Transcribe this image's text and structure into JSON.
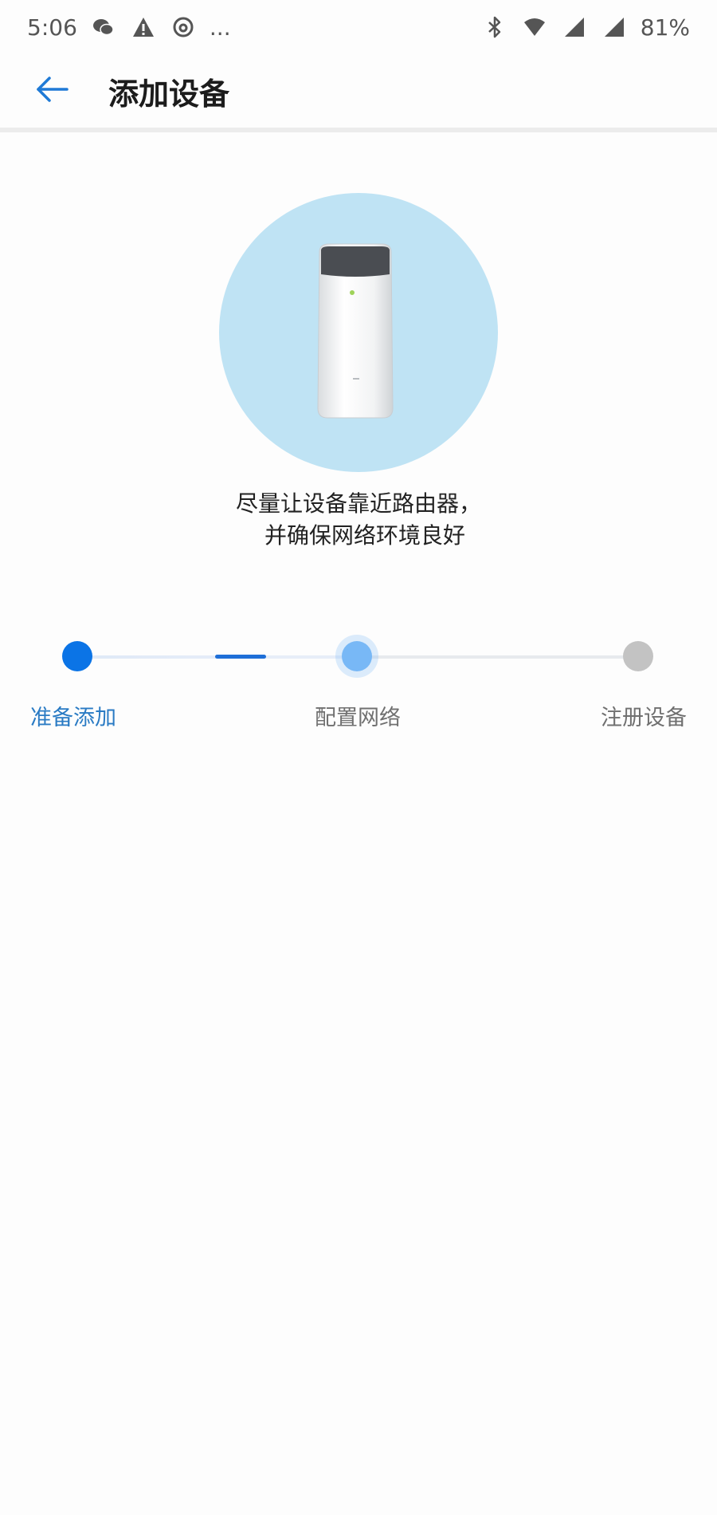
{
  "status_bar": {
    "time": "5:06",
    "more": "...",
    "battery": "81%",
    "icons_left": [
      "wechat-icon",
      "warning-icon",
      "netease-music-icon"
    ],
    "icons_right": [
      "bluetooth-icon",
      "wifi-icon",
      "signal-icon",
      "signal-icon"
    ]
  },
  "header": {
    "title": "添加设备",
    "back_icon": "arrow-left-icon"
  },
  "illustration": {
    "circle_color": "#bfe3f4",
    "device": "air-purifier-icon"
  },
  "hint": {
    "line1": "尽量让设备靠近路由器，",
    "line2": "并确保网络环境良好"
  },
  "stepper": {
    "current_step": 1,
    "steps": [
      {
        "label": "准备添加",
        "state": "done",
        "color": "#0b74e6"
      },
      {
        "label": "配置网络",
        "state": "active",
        "color": "#78b8f6"
      },
      {
        "label": "注册设备",
        "state": "pending",
        "color": "#c3c3c3"
      }
    ]
  },
  "colors": {
    "accent": "#1e6fd8",
    "active_label": "#2a7bc4",
    "inactive_label": "#707070"
  }
}
